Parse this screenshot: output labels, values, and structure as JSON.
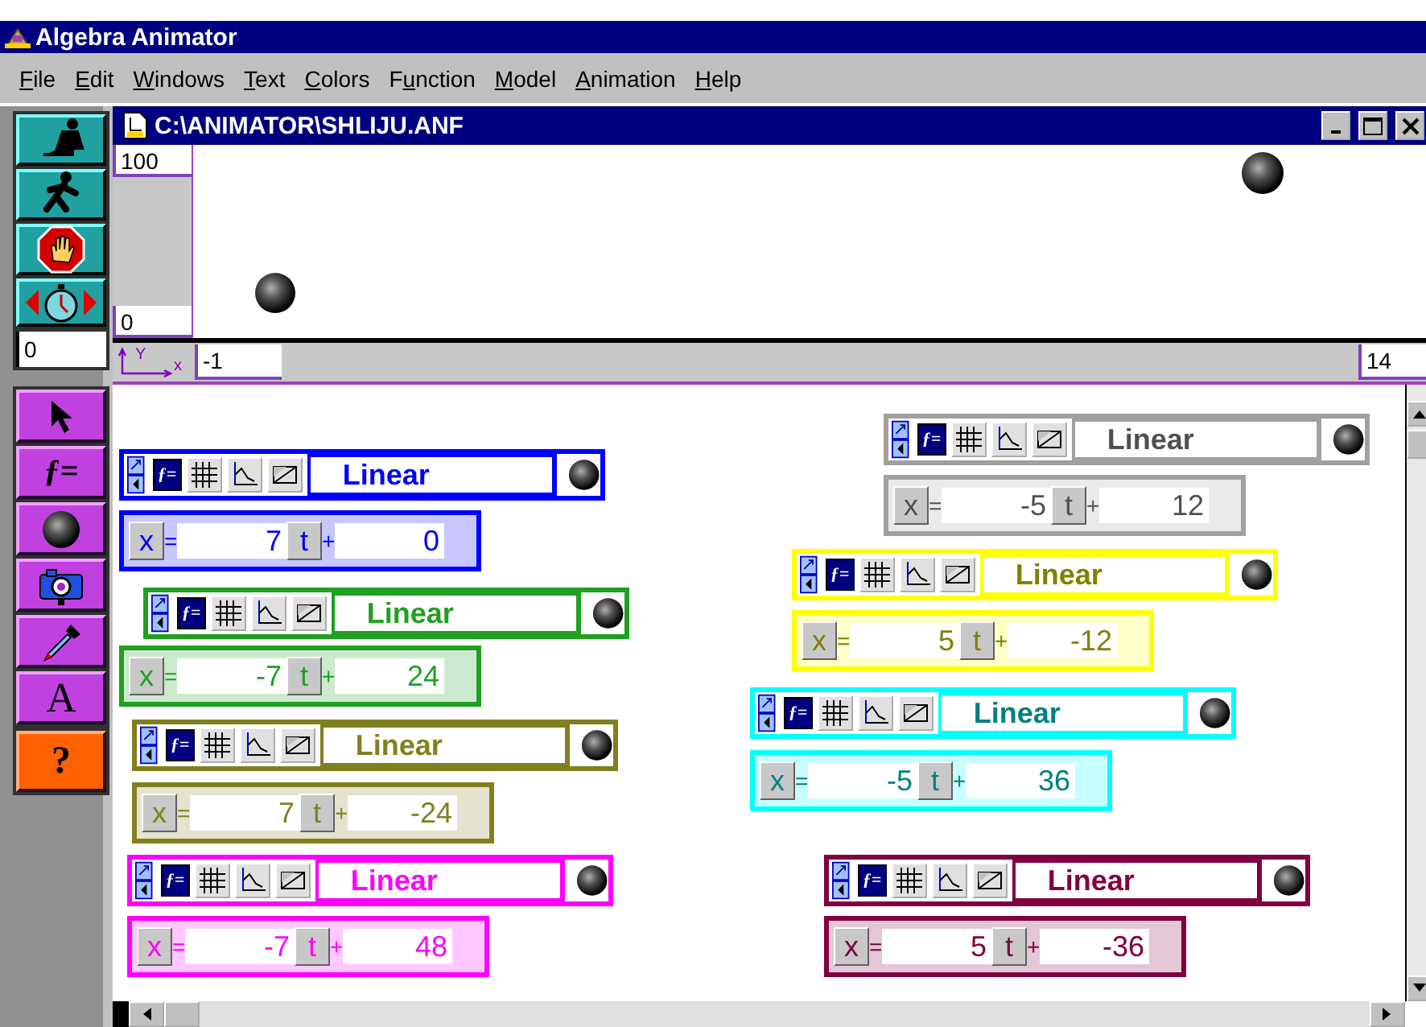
{
  "app_title": "Algebra Animator",
  "menu": [
    {
      "key": "F",
      "after": "ile"
    },
    {
      "key": "E",
      "after": "dit"
    },
    {
      "key": "W",
      "after": "indows"
    },
    {
      "key": "T",
      "after": "ext"
    },
    {
      "key": "C",
      "after": "olors"
    },
    {
      "before": "F",
      "key": "u",
      "after": "nction"
    },
    {
      "key": "M",
      "after": "odel"
    },
    {
      "key": "A",
      "after": "nimation"
    },
    {
      "key": "H",
      "after": "elp"
    }
  ],
  "toolbar": {
    "timer_value": "0",
    "function_tool": "ƒ=",
    "text_tool": "A",
    "help_tool": "?"
  },
  "document": {
    "title": "C:\\ANIMATOR\\SHLIJU.ANF",
    "y_max": "100",
    "y_min": "0",
    "x_min": "-1",
    "x_max": "14",
    "axis_y_label": "Y",
    "axis_x_label": "x"
  },
  "functions": [
    {
      "name": "Linear",
      "mode": "ƒ=",
      "color": "#0000ff",
      "variable": "x",
      "equals": "=",
      "coefficient": "7",
      "parameter": "t",
      "plus": "+",
      "constant": "0"
    },
    {
      "name": "Linear",
      "mode": "ƒ=",
      "color": "#20a020",
      "variable": "x",
      "equals": "=",
      "coefficient": "-7",
      "parameter": "t",
      "plus": "+",
      "constant": "24"
    },
    {
      "name": "Linear",
      "mode": "ƒ=",
      "color": "#808020",
      "variable": "x",
      "equals": "=",
      "coefficient": "7",
      "parameter": "t",
      "plus": "+",
      "constant": "-24"
    },
    {
      "name": "Linear",
      "mode": "ƒ=",
      "color": "#ff00ff",
      "variable": "x",
      "equals": "=",
      "coefficient": "-7",
      "parameter": "t",
      "plus": "+",
      "constant": "48"
    },
    {
      "name": "Linear",
      "mode": "ƒ=",
      "color": "#a0a0a0",
      "variable": "x",
      "equals": "=",
      "coefficient": "-5",
      "parameter": "t",
      "plus": "+",
      "constant": "12"
    },
    {
      "name": "Linear",
      "mode": "ƒ=",
      "color": "#ffff00",
      "variable": "x",
      "equals": "=",
      "coefficient": "5",
      "parameter": "t",
      "plus": "+",
      "constant": "-12"
    },
    {
      "name": "Linear",
      "mode": "ƒ=",
      "color": "#00ffff",
      "variable": "x",
      "equals": "=",
      "coefficient": "-5",
      "parameter": "t",
      "plus": "+",
      "constant": "36"
    },
    {
      "name": "Linear",
      "mode": "ƒ=",
      "color": "#800040",
      "variable": "x",
      "equals": "=",
      "coefficient": "5",
      "parameter": "t",
      "plus": "+",
      "constant": "-36"
    }
  ]
}
